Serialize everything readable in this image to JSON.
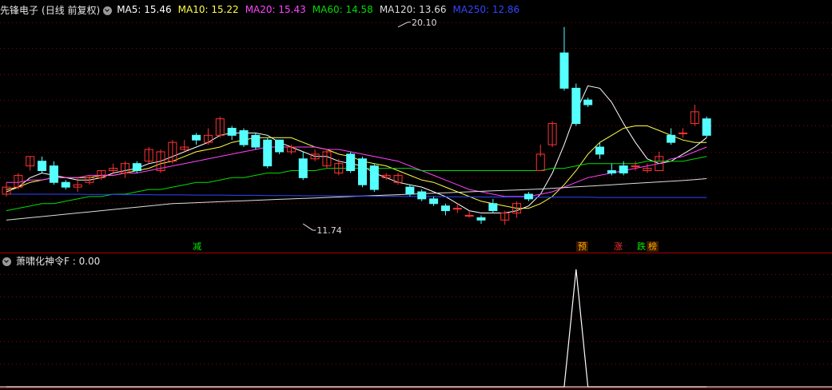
{
  "header": {
    "title": "先锋电子",
    "period": "(日线 前复权)",
    "ma": [
      {
        "label": "MA5",
        "value": "15.46",
        "color": "#ffffff"
      },
      {
        "label": "MA10",
        "value": "15.22",
        "color": "#ffff44"
      },
      {
        "label": "MA20",
        "value": "15.43",
        "color": "#ff44ff"
      },
      {
        "label": "MA60",
        "value": "14.58",
        "color": "#00dd00"
      },
      {
        "label": "MA120",
        "value": "13.66",
        "color": "#dddddd"
      },
      {
        "label": "MA250",
        "value": "12.86",
        "color": "#3344ff"
      }
    ]
  },
  "sub": {
    "indicator_label": "萧啸化神令F",
    "indicator_value": "0.00"
  },
  "markers": [
    {
      "text": "减",
      "color": "#00ee00"
    },
    {
      "text": "预",
      "color": "#ffaa00"
    },
    {
      "text": "涨",
      "color": "#ff3333"
    },
    {
      "text": "跌",
      "color": "#00ee00"
    },
    {
      "text": "榜",
      "color": "#ffaa00"
    }
  ],
  "colors": {
    "up": "#ff3333",
    "down": "#55ffff",
    "grid": "#8b0000",
    "axis": "#aa0000"
  },
  "chart_data": [
    {
      "type": "candlestick",
      "annotations": [
        {
          "text": "20.10",
          "value": 20.1,
          "index": 33
        },
        {
          "text": "11.74",
          "value": 11.74,
          "index": 25
        }
      ],
      "x": [
        1,
        2,
        3,
        4,
        5,
        6,
        7,
        8,
        9,
        10,
        11,
        12,
        13,
        14,
        15,
        16,
        17,
        18,
        19,
        20,
        21,
        22,
        23,
        24,
        25,
        26,
        27,
        28,
        29,
        30,
        31,
        32,
        33,
        34,
        35,
        36,
        37,
        38,
        39,
        40,
        41,
        42,
        43,
        44,
        45,
        46,
        47,
        48,
        49,
        50,
        51,
        52,
        53,
        54,
        55,
        56,
        57,
        58,
        59,
        60
      ],
      "open": [
        13.0,
        13.3,
        14.2,
        14.4,
        14.2,
        13.5,
        13.3,
        13.5,
        13.7,
        14.0,
        13.9,
        14.3,
        14.4,
        14.0,
        14.4,
        14.9,
        15.5,
        15.2,
        15.5,
        15.8,
        15.7,
        15.5,
        15.3,
        15.3,
        14.8,
        14.5,
        14.5,
        14.2,
        13.9,
        14.7,
        14.5,
        14.2,
        13.7,
        13.5,
        13.3,
        13.1,
        12.8,
        12.5,
        12.4,
        12.1,
        12.0,
        12.6,
        11.9,
        12.2,
        13.0,
        14.0,
        15.1,
        19.0,
        17.5,
        17.0,
        15.0,
        14.0,
        14.2,
        14.2,
        14.0,
        14.0,
        15.5,
        15.6,
        16.0,
        16.2
      ],
      "close": [
        13.3,
        13.8,
        14.6,
        14.0,
        13.5,
        13.3,
        13.4,
        13.7,
        14.0,
        14.1,
        14.3,
        14.0,
        14.9,
        14.8,
        15.2,
        15.0,
        15.3,
        15.5,
        16.2,
        15.5,
        15.1,
        15.0,
        14.2,
        14.8,
        15.0,
        13.7,
        14.7,
        14.8,
        14.3,
        14.0,
        13.4,
        13.2,
        13.8,
        13.8,
        13.0,
        12.8,
        12.6,
        12.3,
        12.4,
        12.1,
        11.9,
        12.3,
        12.2,
        12.6,
        12.8,
        14.7,
        16.0,
        17.5,
        16.0,
        16.8,
        14.7,
        13.9,
        13.9,
        14.2,
        14.1,
        14.6,
        15.2,
        15.6,
        16.5,
        15.5
      ],
      "high": [
        13.5,
        13.9,
        14.6,
        14.6,
        14.4,
        13.6,
        13.7,
        13.8,
        14.0,
        14.3,
        14.4,
        14.4,
        15.0,
        14.9,
        15.3,
        15.3,
        15.6,
        15.8,
        16.3,
        15.9,
        15.8,
        15.6,
        15.4,
        15.3,
        15.1,
        14.8,
        14.9,
        14.9,
        14.5,
        14.8,
        14.6,
        14.3,
        13.9,
        13.9,
        13.4,
        13.2,
        12.9,
        12.6,
        12.6,
        12.3,
        12.1,
        12.8,
        12.3,
        12.7,
        13.1,
        15.1,
        16.1,
        20.1,
        17.7,
        17.1,
        15.2,
        14.3,
        14.4,
        14.4,
        14.3,
        14.8,
        15.8,
        15.8,
        16.8,
        16.3
      ],
      "low": [
        12.9,
        13.2,
        14.0,
        13.9,
        13.4,
        13.2,
        13.1,
        13.4,
        13.6,
        13.9,
        13.7,
        13.9,
        14.3,
        13.9,
        14.3,
        14.8,
        15.1,
        15.1,
        15.4,
        15.3,
        15.0,
        14.9,
        14.1,
        14.7,
        14.7,
        13.6,
        14.4,
        14.1,
        13.8,
        13.9,
        13.3,
        13.1,
        13.6,
        13.4,
        12.9,
        12.7,
        12.5,
        12.1,
        12.2,
        12.0,
        11.74,
        12.2,
        11.7,
        12.0,
        12.7,
        14.6,
        15.0,
        17.4,
        15.9,
        16.7,
        14.5,
        13.8,
        13.8,
        14.0,
        13.9,
        14.4,
        15.1,
        15.4,
        15.9,
        15.4
      ],
      "series": [
        {
          "name": "MA5",
          "values": [
            13.1,
            13.3,
            13.7,
            13.9,
            13.8,
            13.7,
            13.6,
            13.6,
            13.7,
            13.9,
            14.0,
            14.1,
            14.3,
            14.4,
            14.6,
            14.8,
            15.0,
            15.2,
            15.5,
            15.6,
            15.6,
            15.6,
            15.5,
            15.2,
            15.0,
            14.8,
            14.6,
            14.6,
            14.4,
            14.3,
            14.2,
            13.9,
            13.7,
            13.5,
            13.4,
            13.3,
            13.1,
            12.9,
            12.6,
            12.3,
            12.2,
            12.2,
            12.2,
            12.3,
            12.5,
            13.0,
            13.9,
            15.1,
            16.5,
            17.6,
            17.5,
            16.9,
            16.0,
            15.2,
            14.5,
            14.3,
            14.4,
            14.7,
            15.0,
            15.4
          ]
        },
        {
          "name": "MA10",
          "values": [
            13.2,
            13.3,
            13.5,
            13.6,
            13.7,
            13.7,
            13.7,
            13.7,
            13.8,
            13.8,
            13.9,
            14.0,
            14.1,
            14.3,
            14.4,
            14.6,
            14.8,
            14.9,
            15.0,
            15.2,
            15.3,
            15.4,
            15.4,
            15.4,
            15.4,
            15.2,
            15.0,
            14.9,
            14.7,
            14.6,
            14.4,
            14.3,
            14.2,
            14.0,
            13.8,
            13.6,
            13.5,
            13.3,
            13.1,
            12.9,
            12.7,
            12.6,
            12.5,
            12.4,
            12.4,
            12.6,
            12.9,
            13.4,
            14.0,
            14.7,
            15.2,
            15.5,
            15.8,
            15.9,
            15.9,
            15.7,
            15.5,
            15.3,
            15.2,
            15.2
          ]
        },
        {
          "name": "MA20",
          "values": [
            13.5,
            13.5,
            13.6,
            13.6,
            13.7,
            13.7,
            13.7,
            13.8,
            13.8,
            13.8,
            13.9,
            13.9,
            14.0,
            14.1,
            14.2,
            14.3,
            14.4,
            14.5,
            14.6,
            14.7,
            14.8,
            14.9,
            15.0,
            15.0,
            15.0,
            15.0,
            15.0,
            14.9,
            14.9,
            14.8,
            14.7,
            14.6,
            14.5,
            14.4,
            14.2,
            14.0,
            13.8,
            13.6,
            13.4,
            13.2,
            13.1,
            13.0,
            12.9,
            12.9,
            12.9,
            13.0,
            13.1,
            13.3,
            13.5,
            13.7,
            13.8,
            13.9,
            14.0,
            14.1,
            14.2,
            14.3,
            14.5,
            14.6,
            14.8,
            15.0
          ]
        },
        {
          "name": "MA60",
          "values": [
            12.3,
            12.4,
            12.5,
            12.6,
            12.6,
            12.7,
            12.8,
            12.9,
            12.9,
            13.0,
            13.0,
            13.1,
            13.2,
            13.2,
            13.3,
            13.4,
            13.5,
            13.5,
            13.6,
            13.7,
            13.7,
            13.8,
            13.9,
            13.9,
            14.0,
            14.0,
            14.0,
            14.1,
            14.1,
            14.1,
            14.1,
            14.1,
            14.1,
            14.1,
            14.1,
            14.0,
            14.0,
            14.0,
            14.0,
            14.0,
            14.0,
            14.0,
            14.0,
            14.0,
            14.0,
            14.0,
            14.1,
            14.1,
            14.2,
            14.3,
            14.3,
            14.3,
            14.3,
            14.3,
            14.4,
            14.4,
            14.4,
            14.4,
            14.5,
            14.6
          ]
        },
        {
          "name": "MA120",
          "values": [
            11.9,
            11.95,
            12.0,
            12.05,
            12.1,
            12.15,
            12.2,
            12.25,
            12.3,
            12.35,
            12.4,
            12.45,
            12.5,
            12.55,
            12.6,
            12.62,
            12.64,
            12.66,
            12.68,
            12.7,
            12.72,
            12.74,
            12.76,
            12.78,
            12.8,
            12.82,
            12.84,
            12.86,
            12.88,
            12.9,
            12.92,
            12.94,
            12.96,
            12.98,
            13.0,
            13.02,
            13.04,
            13.06,
            13.08,
            13.1,
            13.12,
            13.14,
            13.16,
            13.18,
            13.2,
            13.22,
            13.25,
            13.28,
            13.31,
            13.34,
            13.37,
            13.4,
            13.43,
            13.46,
            13.49,
            13.52,
            13.55,
            13.58,
            13.62,
            13.66
          ]
        },
        {
          "name": "MA250",
          "values": [
            13.0,
            13.0,
            13.0,
            13.0,
            13.0,
            13.0,
            13.0,
            12.99,
            12.99,
            12.99,
            12.98,
            12.98,
            12.98,
            12.97,
            12.97,
            12.97,
            12.96,
            12.96,
            12.96,
            12.95,
            12.95,
            12.95,
            12.94,
            12.94,
            12.94,
            12.93,
            12.93,
            12.93,
            12.92,
            12.92,
            12.92,
            12.91,
            12.91,
            12.91,
            12.9,
            12.9,
            12.9,
            12.89,
            12.89,
            12.89,
            12.88,
            12.88,
            12.88,
            12.88,
            12.87,
            12.87,
            12.87,
            12.87,
            12.87,
            12.87,
            12.86,
            12.86,
            12.86,
            12.86,
            12.86,
            12.86,
            12.86,
            12.86,
            12.86,
            12.86
          ]
        }
      ]
    },
    {
      "type": "line",
      "name": "萧啸化神令F",
      "x": [
        1,
        2,
        3,
        4,
        5,
        6,
        7,
        8,
        9,
        10,
        11,
        12,
        13,
        14,
        15,
        16,
        17,
        18,
        19,
        20,
        21,
        22,
        23,
        24,
        25,
        26,
        27,
        28,
        29,
        30,
        31,
        32,
        33,
        34,
        35,
        36,
        37,
        38,
        39,
        40,
        41,
        42,
        43,
        44,
        45,
        46,
        47,
        48,
        49,
        50,
        51,
        52,
        53,
        54,
        55,
        56,
        57,
        58,
        59,
        60
      ],
      "values": [
        0,
        0,
        0,
        0,
        0,
        0,
        0,
        0,
        0,
        0,
        0,
        0,
        0,
        0,
        0,
        0,
        0,
        0,
        0,
        0,
        0,
        0,
        0,
        0,
        0,
        0,
        0,
        0,
        0,
        0,
        0,
        0,
        0,
        0,
        0,
        0,
        0,
        0,
        0,
        0,
        0,
        0,
        0,
        0,
        0,
        0,
        0,
        0,
        1,
        0,
        0,
        0,
        0,
        0,
        0,
        0,
        0,
        0,
        0,
        0
      ]
    }
  ]
}
